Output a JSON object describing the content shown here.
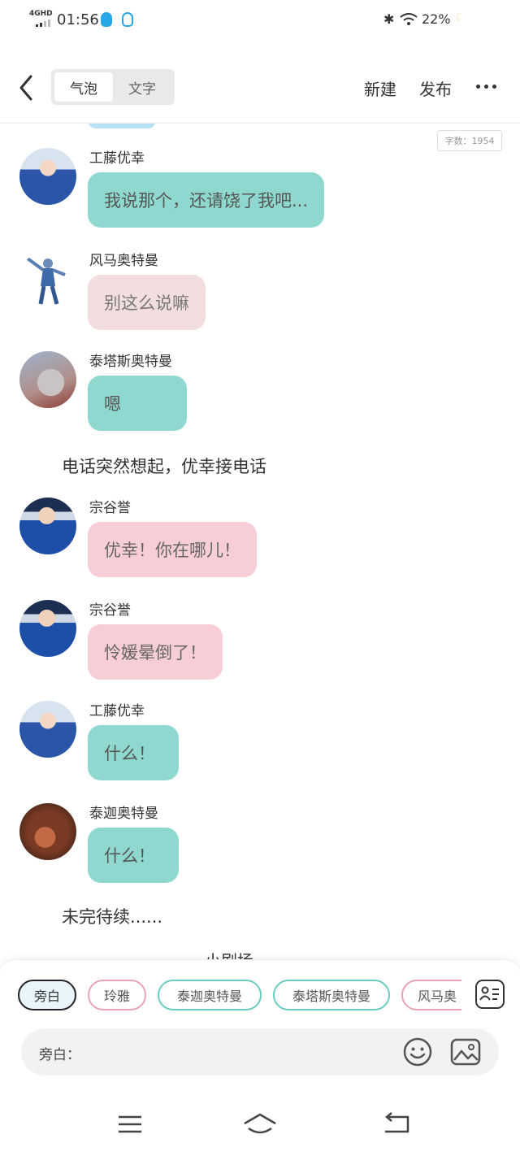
{
  "status_bar": {
    "network": "4GHD",
    "time": "01:56",
    "battery": "22%"
  },
  "header": {
    "tabs": [
      {
        "label": "气泡",
        "active": true
      },
      {
        "label": "文字",
        "active": false
      }
    ],
    "new_label": "新建",
    "publish_label": "发布"
  },
  "chat": {
    "word_count": "字数：1954",
    "messages": [
      {
        "speaker": "工藤优幸",
        "text": "我说那个，还请饶了我吧...",
        "color": "#8fd8cf"
      },
      {
        "speaker": "风马奥特曼",
        "text": "别这么说嘛",
        "color": "#f2dede"
      },
      {
        "speaker": "泰塔斯奥特曼",
        "text": "嗯",
        "color": "#8fd8cf"
      },
      {
        "speaker": "宗谷誉",
        "text": "优幸！你在哪儿！",
        "color": "#f7cdd6"
      },
      {
        "speaker": "宗谷誉",
        "text": "怜媛晕倒了！",
        "color": "#f7cdd6"
      },
      {
        "speaker": "工藤优幸",
        "text": "什么！",
        "color": "#8fd8cf"
      },
      {
        "speaker": "泰迦奥特曼",
        "text": "什么！",
        "color": "#8fd8cf"
      }
    ],
    "narrations": [
      "电话突然想起，优幸接电话",
      "未完待续......"
    ],
    "cut_text": "小剧场"
  },
  "composer": {
    "chips": [
      "旁白",
      "玲雅",
      "泰迦奥特曼",
      "泰塔斯奥特曼",
      "风马奥"
    ],
    "selected_chip": "旁白",
    "input_label": "旁白："
  },
  "colors": {
    "teal_bubble": "#8fd8cf",
    "pink_bubble": "#f7cdd6",
    "light_pink_bubble": "#f2dede"
  }
}
